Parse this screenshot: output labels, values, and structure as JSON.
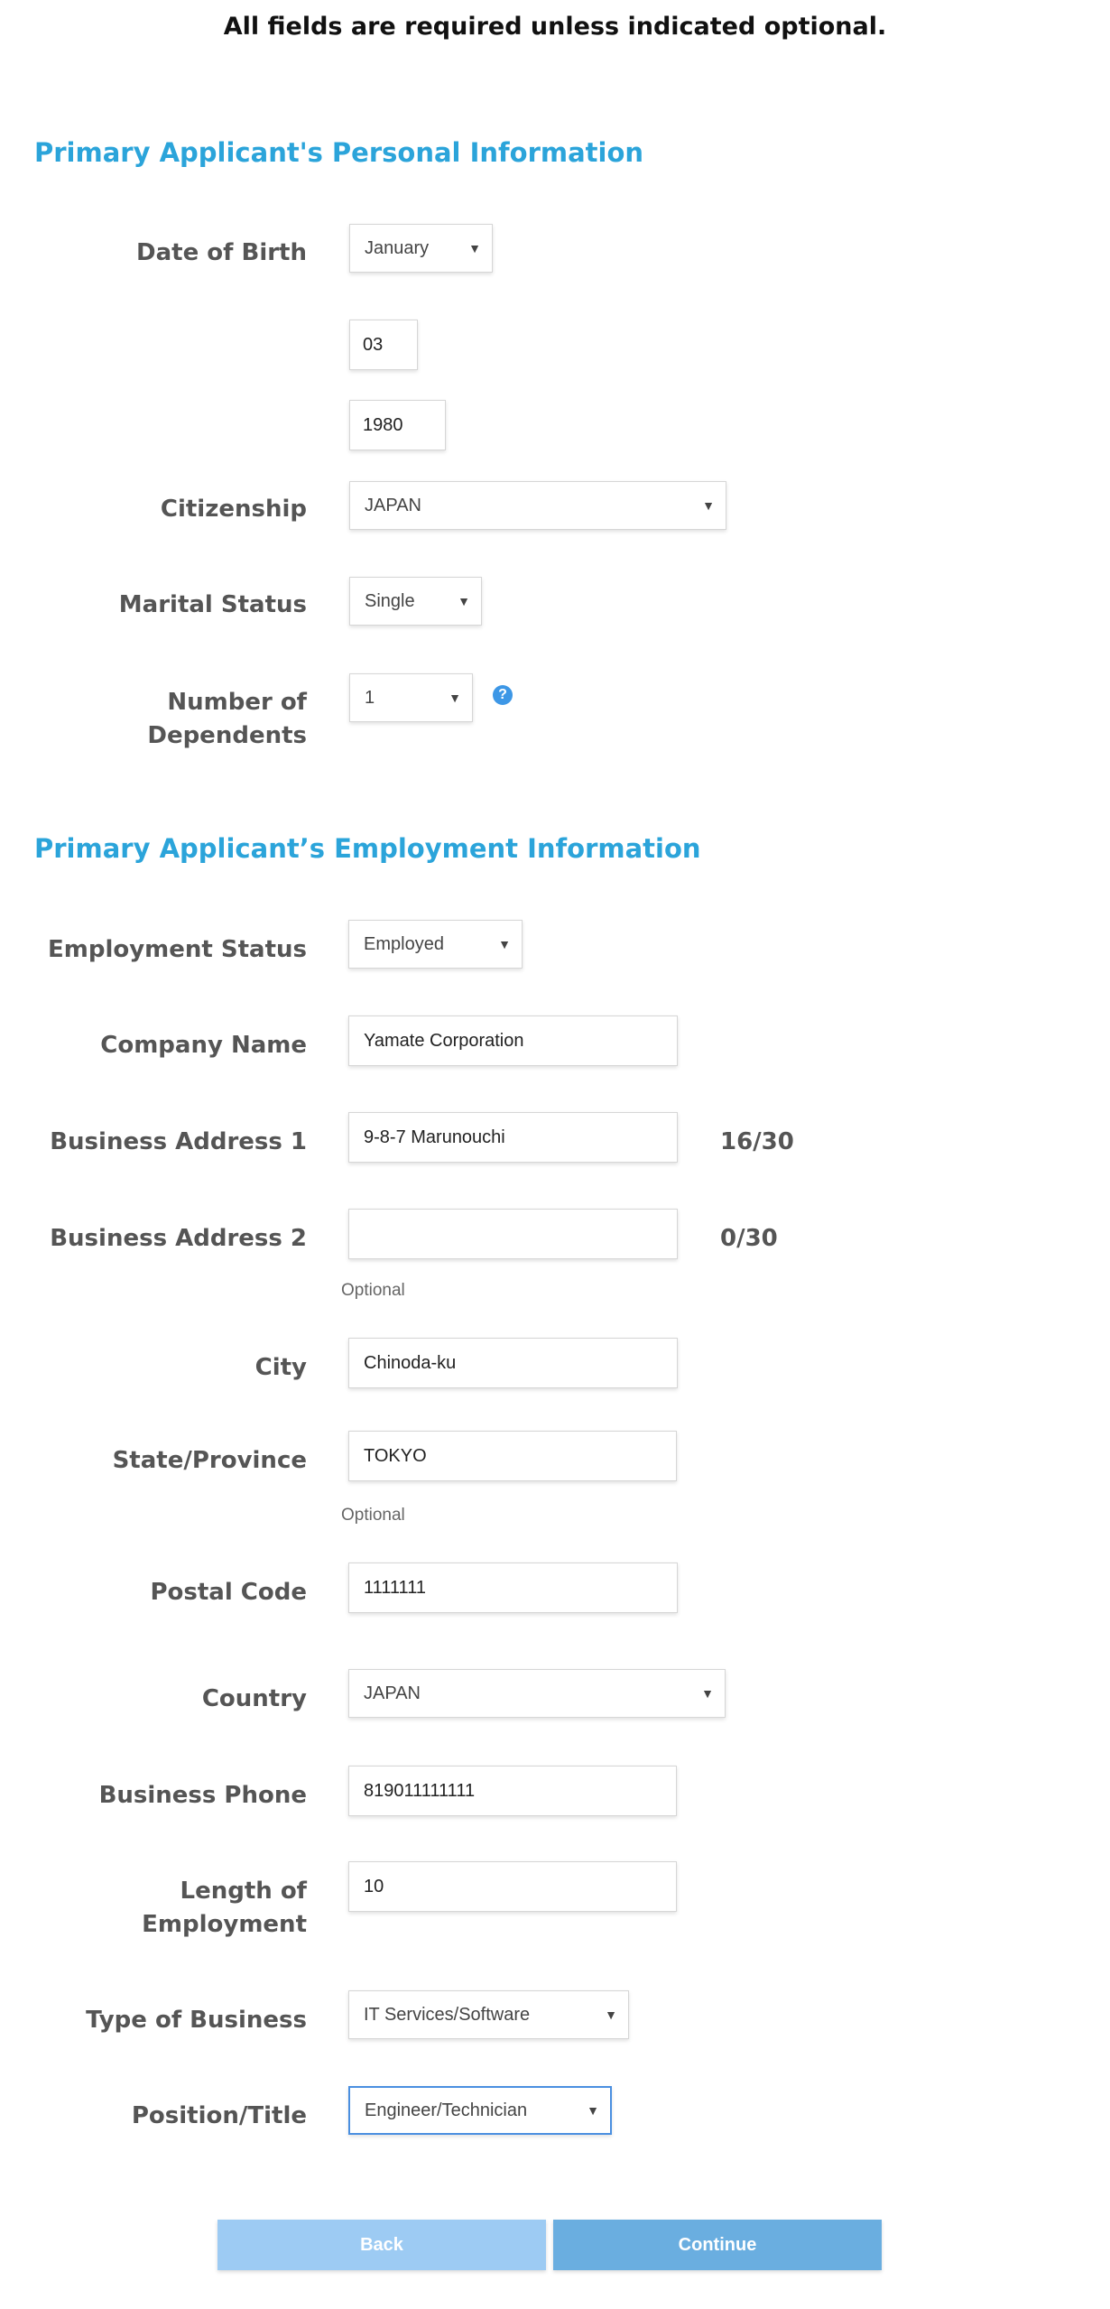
{
  "notice": "All fields are required unless indicated optional.",
  "personal": {
    "title": "Primary Applicant's Personal Information",
    "dob_label": "Date of Birth",
    "dob_month": "January",
    "dob_day": "03",
    "dob_year": "1980",
    "citizenship_label": "Citizenship",
    "citizenship": "JAPAN",
    "marital_label": "Marital Status",
    "marital": "Single",
    "dependents_label_1": "Number of",
    "dependents_label_2": "Dependents",
    "dependents": "1",
    "help_glyph": "?"
  },
  "employment": {
    "title": "Primary Applicant’s Employment Information",
    "status_label": "Employment Status",
    "status": "Employed",
    "company_label": "Company Name",
    "company": "Yamate Corporation",
    "addr1_label": "Business Address 1",
    "addr1": "9-8-7 Marunouchi",
    "addr1_count": "16/30",
    "addr2_label": "Business Address 2",
    "addr2": "",
    "addr2_count": "0/30",
    "addr2_hint": "Optional",
    "city_label": "City",
    "city": "Chinoda-ku",
    "state_label": "State/Province",
    "state": "TOKYO",
    "state_hint": "Optional",
    "postal_label": "Postal Code",
    "postal": "1111111",
    "country_label": "Country",
    "country": "JAPAN",
    "phone_label": "Business Phone",
    "phone": "819011111111",
    "length_label_1": "Length of",
    "length_label_2": "Employment",
    "length": "10",
    "business_type_label": "Type of Business",
    "business_type": "IT Services/Software",
    "position_label": "Position/Title",
    "position": "Engineer/Technician"
  },
  "actions": {
    "back": "Back",
    "continue": "Continue"
  },
  "colors": {
    "section_title": "#2ba4da",
    "back_button": "#9dcbf3",
    "continue_button": "#6aaee0",
    "help_icon": "#3d97e6"
  },
  "icons": {
    "caret": "chevron-down-icon",
    "help": "help-icon"
  }
}
